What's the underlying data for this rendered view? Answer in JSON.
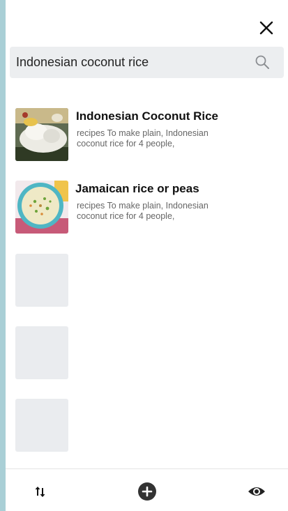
{
  "search": {
    "value": "Indonesian coconut rice",
    "placeholder": ""
  },
  "results": [
    {
      "title": "Indonesian Coconut Rice",
      "description": "recipes To make plain, Indonesian coconut rice for 4 people,"
    },
    {
      "title": "Jamaican rice or peas",
      "description": "recipes To make plain, Indonesian coconut rice for 4 people,"
    }
  ],
  "placeholder_count": 3,
  "toolbar": {
    "sort_icon": "sort-arrows-icon",
    "add_icon": "plus-circle-icon",
    "view_icon": "eye-icon"
  },
  "colors": {
    "backdrop": "#a9cfd6",
    "search_bg": "#eceef0",
    "placeholder": "#eaecef",
    "icon": "#222222"
  }
}
